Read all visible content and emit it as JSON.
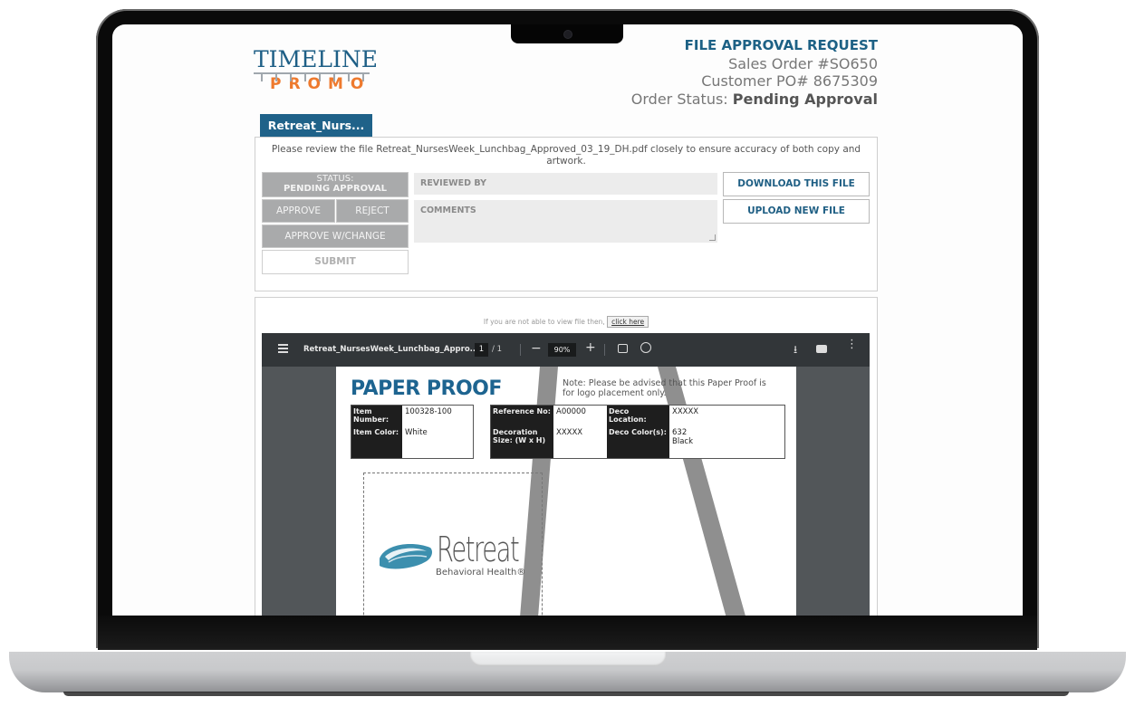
{
  "header": {
    "logo": {
      "top": "TIMELINE",
      "bottom": "PROMO"
    },
    "request_title": "FILE APPROVAL REQUEST",
    "sales_order": "Sales Order #SO650",
    "customer_po": "Customer PO# 8675309",
    "order_status_label": "Order Status:",
    "order_status_value": "Pending Approval"
  },
  "file_tab": {
    "label": "Retreat_Nurs..."
  },
  "review_panel": {
    "instruction": "Please review the file Retreat_NursesWeek_Lunchbag_Approved_03_19_DH.pdf closely to ensure accuracy of both copy and artwork.",
    "status_label": "STATUS:",
    "status_value": "PENDING APPROVAL",
    "approve_label": "APPROVE",
    "reject_label": "REJECT",
    "approve_change_label": "APPROVE W/CHANGE",
    "submit_label": "SUBMIT",
    "reviewed_by_placeholder": "REVIEWED BY",
    "comments_placeholder": "COMMENTS",
    "download_label": "DOWNLOAD THIS FILE",
    "upload_label": "UPLOAD NEW FILE"
  },
  "viewer": {
    "fallback_text": "If you are not able to view file then,",
    "fallback_link": "click here",
    "toolbar": {
      "file_name": "Retreat_NursesWeek_Lunchbag_Appro...",
      "current_page": "1",
      "total_pages": "/  1",
      "zoom": "90%",
      "minus": "−",
      "plus": "+",
      "download_icon": "⭳",
      "more_icon": "⋮"
    },
    "proof": {
      "title": "PAPER PROOF",
      "note": "Note: Please be advised that this Paper Proof is for logo placement only.",
      "item_number_label": "Item Number:",
      "item_number": "100328-100",
      "item_color_label": "Item Color:",
      "item_color": "White",
      "reference_label": "Reference No:",
      "reference": "A00000",
      "deco_size_label": "Decoration Size: (W x H)",
      "deco_size": "XXXXX",
      "deco_location_label": "Deco Location:",
      "deco_location": "XXXXX",
      "deco_colors_label": "Deco Color(s):",
      "deco_colors_1": "632",
      "deco_colors_2": "Black",
      "brand_name": "Retreat",
      "brand_sub": "Behavioral Health®"
    }
  },
  "colors": {
    "brand_blue": "#1f6289",
    "brand_orange": "#ee7a2e",
    "button_gray": "#a9aaab",
    "pdf_toolbar": "#323639"
  }
}
